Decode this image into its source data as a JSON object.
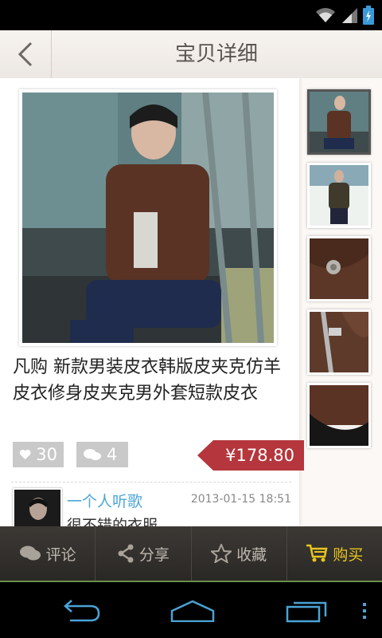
{
  "header": {
    "title": "宝贝详细"
  },
  "product": {
    "name": "凡购 新款男装皮衣韩版皮夹克仿羊皮衣修身皮夹克男外套短款皮衣",
    "likes": "30",
    "comments": "4",
    "price": "¥178.80"
  },
  "comment": {
    "user": "一个人听歌",
    "time": "2013-01-15 18:51",
    "text": "很不错的衣服"
  },
  "tabs": [
    {
      "label": "评论",
      "icon": "comment-icon"
    },
    {
      "label": "分享",
      "icon": "share-icon"
    },
    {
      "label": "收藏",
      "icon": "star-icon"
    },
    {
      "label": "购买",
      "icon": "cart-icon"
    }
  ],
  "colors": {
    "price_tag": "#b5363c",
    "buy": "#e8c51d",
    "username": "#4da6d8",
    "accent_line": "#6b8f4d"
  }
}
